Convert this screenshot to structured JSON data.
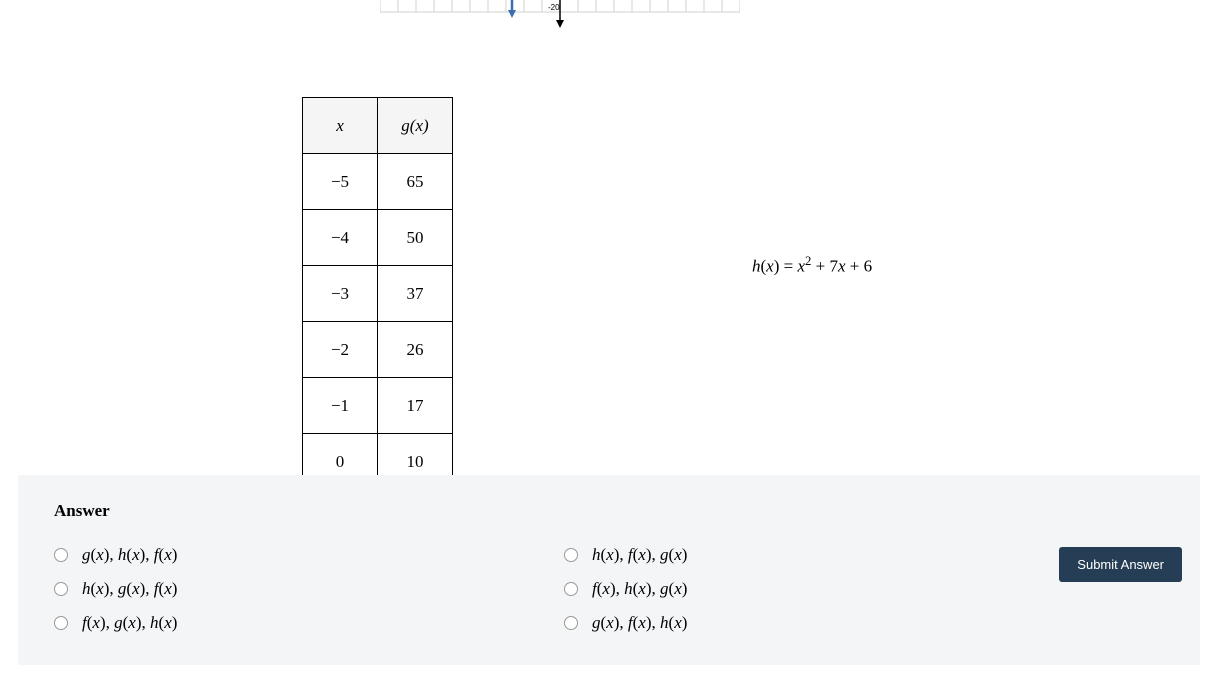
{
  "graph": {
    "neg20_label": "-20"
  },
  "table": {
    "header": {
      "x": "x",
      "g": "g(x)"
    },
    "rows": [
      {
        "x": "−5",
        "g": "65"
      },
      {
        "x": "−4",
        "g": "50"
      },
      {
        "x": "−3",
        "g": "37"
      },
      {
        "x": "−2",
        "g": "26"
      },
      {
        "x": "−1",
        "g": "17"
      },
      {
        "x": "0",
        "g": "10"
      }
    ]
  },
  "formula": {
    "fn": "h",
    "var": "x",
    "eq": " = ",
    "sq_var": "x",
    "sq_exp": "2",
    "plus1": " + 7",
    "lin_var": "x",
    "plus2": " + 6"
  },
  "answer": {
    "heading": "Answer",
    "options_left": [
      {
        "g": "g",
        "h": "h",
        "f": "f",
        "order": [
          "g",
          "h",
          "f"
        ]
      },
      {
        "g": "g",
        "h": "h",
        "f": "f",
        "order": [
          "h",
          "g",
          "f"
        ]
      },
      {
        "g": "g",
        "h": "h",
        "f": "f",
        "order": [
          "f",
          "g",
          "h"
        ]
      }
    ],
    "options_right": [
      {
        "g": "g",
        "h": "h",
        "f": "f",
        "order": [
          "h",
          "f",
          "g"
        ]
      },
      {
        "g": "g",
        "h": "h",
        "f": "f",
        "order": [
          "f",
          "h",
          "g"
        ]
      },
      {
        "g": "g",
        "h": "h",
        "f": "f",
        "order": [
          "g",
          "f",
          "h"
        ]
      }
    ],
    "left_text": [
      "g(x), h(x), f(x)",
      "h(x), g(x), f(x)",
      "f(x), g(x), h(x)"
    ],
    "right_text": [
      "h(x), f(x), g(x)",
      "f(x), h(x), g(x)",
      "g(x), f(x), h(x)"
    ],
    "submit": "Submit Answer"
  }
}
